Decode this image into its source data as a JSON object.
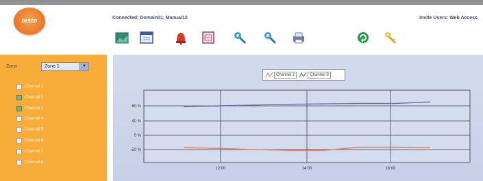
{
  "logo": {
    "text": "testo"
  },
  "header": {
    "connected_text": "Connected: Domain01, Manual12",
    "user_text": "Invite Users: Web Access"
  },
  "toolbar": {
    "icons": [
      "chart-icon",
      "calendar-icon",
      "alarm-bell-icon",
      "report-icon",
      "tool-icon",
      "search-tool-icon",
      "print-icon",
      "refresh-icon",
      "key-icon"
    ]
  },
  "sidebar": {
    "zone_label": "Zone",
    "zone_value": "Zone 1",
    "channels": [
      {
        "label": "Channel 1",
        "checked": false
      },
      {
        "label": "Channel 2",
        "checked": true
      },
      {
        "label": "Channel 3",
        "checked": true
      },
      {
        "label": "Channel 4",
        "checked": false
      },
      {
        "label": "Channel 5",
        "checked": false
      },
      {
        "label": "Channel 6",
        "checked": false
      },
      {
        "label": "Channel 7",
        "checked": false
      },
      {
        "label": "Channel 8",
        "checked": false
      }
    ]
  },
  "chart_data": {
    "type": "line",
    "legend": [
      "Channel 2",
      "Channel 3"
    ],
    "y_ticks": [
      "60 %",
      "40 %",
      "0 %",
      "-50 %"
    ],
    "x_ticks": [
      "12:00",
      "14:00",
      "16:00"
    ],
    "series": [
      {
        "name": "Channel 2",
        "color": "#e3795e",
        "values": [
          -45,
          -47,
          -50,
          -52,
          -52,
          -44,
          -44,
          -45
        ]
      },
      {
        "name": "Channel 3",
        "color": "#6474a8",
        "values": [
          58,
          60,
          62,
          64,
          65,
          66,
          66,
          70
        ]
      }
    ]
  }
}
